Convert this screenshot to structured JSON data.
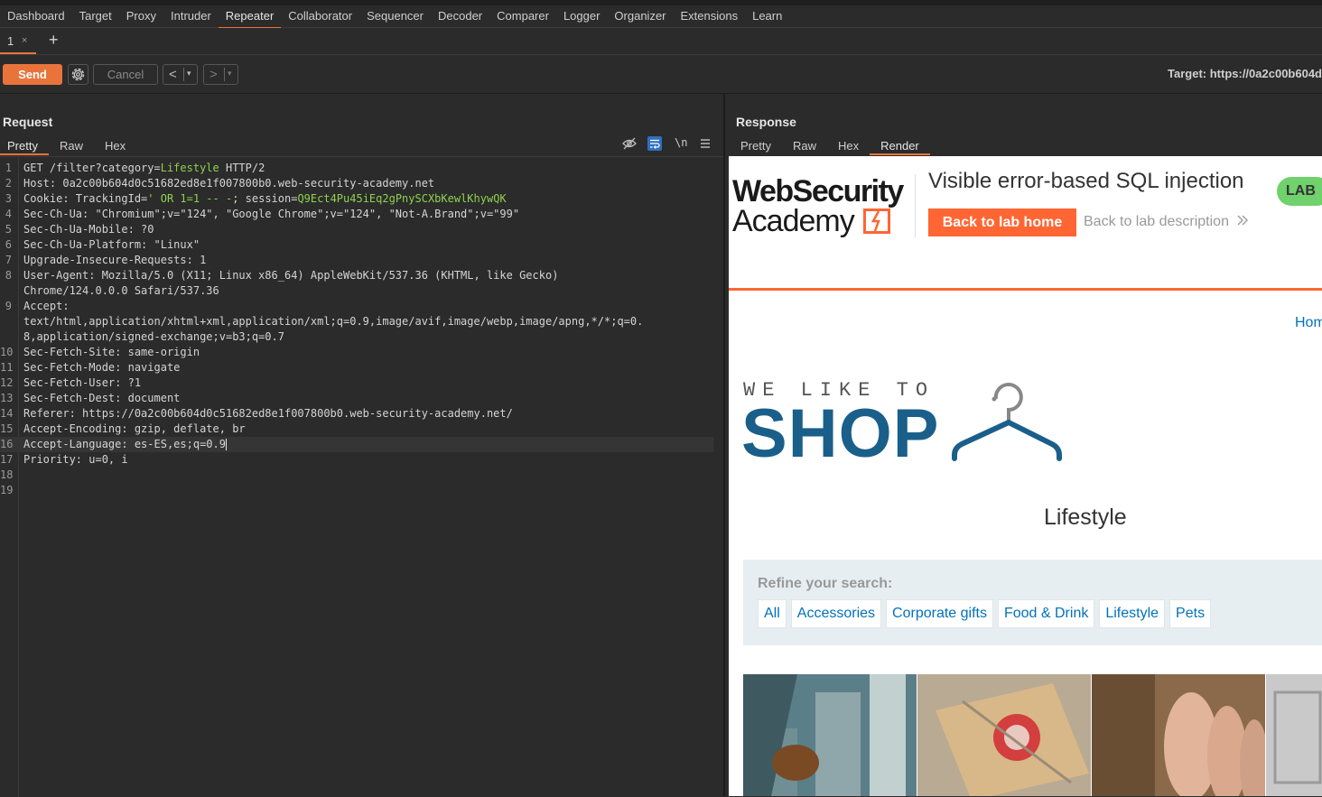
{
  "main_nav": [
    "Dashboard",
    "Target",
    "Proxy",
    "Intruder",
    "Repeater",
    "Collaborator",
    "Sequencer",
    "Decoder",
    "Comparer",
    "Logger",
    "Organizer",
    "Extensions",
    "Learn"
  ],
  "repeater_tab": {
    "number": "1",
    "close": "×",
    "add": "+"
  },
  "toolbar": {
    "send": "Send",
    "cancel": "Cancel",
    "prev": "<",
    "next": ">",
    "dropdown": "▾",
    "target": "Target: https://0a2c00b604d"
  },
  "request": {
    "title": "Request",
    "tabs": [
      "Pretty",
      "Raw",
      "Hex"
    ],
    "icons": {
      "hide": "eye-slash-icon",
      "wrap": "wrap-icon",
      "newline": "\\n",
      "menu": "menu-icon"
    },
    "lines": [
      {
        "n": "1",
        "parts": [
          [
            "GET /filter?category=",
            "n"
          ],
          [
            "Lifestyle",
            "g"
          ],
          [
            " HTTP/2",
            "n"
          ]
        ]
      },
      {
        "n": "2",
        "parts": [
          [
            "Host: 0a2c00b604d0c51682ed8e1f007800b0.web-security-academy.net",
            "n"
          ]
        ]
      },
      {
        "n": "3",
        "parts": [
          [
            "Cookie: ",
            "n"
          ],
          [
            "TrackingId",
            "n"
          ],
          [
            "=",
            "n"
          ],
          [
            "' OR 1=1 -- -",
            "g"
          ],
          [
            "; session=",
            "n"
          ],
          [
            "Q9Ect4Pu45iEq2gPnySCXbKewlKhywQK",
            "g"
          ]
        ]
      },
      {
        "n": "4",
        "parts": [
          [
            "Sec-Ch-Ua: \"Chromium\";v=\"124\", \"Google Chrome\";v=\"124\", \"Not-A.Brand\";v=\"99\"",
            "n"
          ]
        ]
      },
      {
        "n": "5",
        "parts": [
          [
            "Sec-Ch-Ua-Mobile: ?0",
            "n"
          ]
        ]
      },
      {
        "n": "6",
        "parts": [
          [
            "Sec-Ch-Ua-Platform: \"Linux\"",
            "n"
          ]
        ]
      },
      {
        "n": "7",
        "parts": [
          [
            "Upgrade-Insecure-Requests: 1",
            "n"
          ]
        ]
      },
      {
        "n": "8",
        "parts": [
          [
            "User-Agent: Mozilla/5.0 (X11; Linux x86_64) AppleWebKit/537.36 (KHTML, like Gecko)",
            "n"
          ]
        ]
      },
      {
        "n": "",
        "parts": [
          [
            "Chrome/124.0.0.0 Safari/537.36",
            "n"
          ]
        ]
      },
      {
        "n": "9",
        "parts": [
          [
            "Accept:",
            "n"
          ]
        ]
      },
      {
        "n": "",
        "parts": [
          [
            "text/html,application/xhtml+xml,application/xml;q=0.9,image/avif,image/webp,image/apng,*/*;q=0.",
            "n"
          ]
        ]
      },
      {
        "n": "",
        "parts": [
          [
            "8,application/signed-exchange;v=b3;q=0.7",
            "n"
          ]
        ]
      },
      {
        "n": "10",
        "parts": [
          [
            "Sec-Fetch-Site: same-origin",
            "n"
          ]
        ]
      },
      {
        "n": "11",
        "parts": [
          [
            "Sec-Fetch-Mode: navigate",
            "n"
          ]
        ]
      },
      {
        "n": "12",
        "parts": [
          [
            "Sec-Fetch-User: ?1",
            "n"
          ]
        ]
      },
      {
        "n": "13",
        "parts": [
          [
            "Sec-Fetch-Dest: document",
            "n"
          ]
        ]
      },
      {
        "n": "14",
        "parts": [
          [
            "Referer: https://0a2c00b604d0c51682ed8e1f007800b0.web-security-academy.net/",
            "n"
          ]
        ]
      },
      {
        "n": "15",
        "parts": [
          [
            "Accept-Encoding: gzip, deflate, br",
            "n"
          ]
        ]
      },
      {
        "n": "16",
        "parts": [
          [
            "Accept-Language: es-ES,es;q=0.9",
            "n"
          ]
        ],
        "cursor": true
      },
      {
        "n": "17",
        "parts": [
          [
            "Priority: u=0, i",
            "n"
          ]
        ]
      },
      {
        "n": "18",
        "parts": []
      },
      {
        "n": "19",
        "parts": []
      }
    ]
  },
  "response": {
    "title": "Response",
    "tabs": [
      "Pretty",
      "Raw",
      "Hex",
      "Render"
    ],
    "render": {
      "logo_line1": "WebSecurity",
      "logo_line2": "Academy",
      "lab_title": "Visible error-based SQL injection",
      "back_button": "Back to lab home",
      "desc_link": "Back to lab description",
      "badge": "LAB",
      "home_link": "Hom",
      "shop_tag": "WE LIKE TO",
      "shop_word": "SHOP",
      "category_heading": "Lifestyle",
      "refine_label": "Refine your search:",
      "filters": [
        "All",
        "Accessories",
        "Corporate gifts",
        "Food & Drink",
        "Lifestyle",
        "Pets"
      ]
    }
  },
  "colors": {
    "accent": "#e8743b",
    "lab_orange": "#ff6633",
    "lab_green": "#70d16d",
    "link_blue": "#0071bc",
    "shop_blue": "#1a5f8a",
    "code_green": "#8fd14f"
  }
}
